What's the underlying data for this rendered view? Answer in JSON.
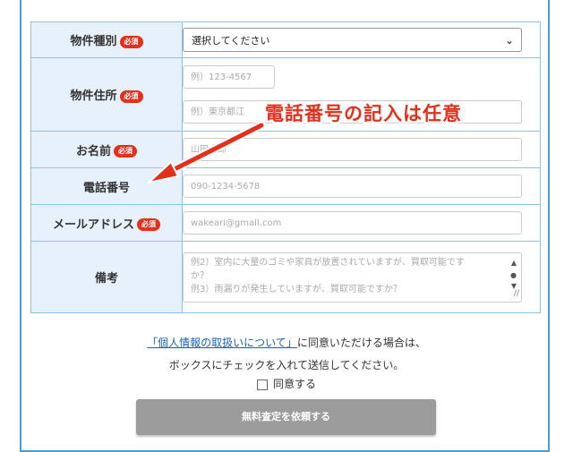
{
  "required_badge": "必須",
  "fields": {
    "property_type": {
      "label": "物件種別",
      "value": "選択してください"
    },
    "property_address": {
      "label": "物件住所",
      "postal_placeholder": "例）123-4567",
      "address_placeholder": "例）東京都江"
    },
    "name": {
      "label": "お名前",
      "placeholder": "山田太郎"
    },
    "phone": {
      "label": "電話番号",
      "placeholder": "090-1234-5678"
    },
    "email": {
      "label": "メールアドレス",
      "placeholder": "wakeari@gmail.com"
    },
    "notes": {
      "label": "備考",
      "placeholder_line1": "例2）室内に大量のゴミや家具が放置されていますが、買取可能です",
      "placeholder_line2": "か？",
      "placeholder_line3": "例3）雨漏りが発生していますが、買取可能ですか？"
    }
  },
  "annotation": {
    "text": "電話番号の記入は任意",
    "color": "#e3301c"
  },
  "consent": {
    "link_text": "「個人情報の取扱いについて」",
    "line1_rest": "に同意いただける場合は、",
    "line2": "ボックスにチェックを入れて送信してください。",
    "checkbox_label": "同意する",
    "checked": false
  },
  "submit_label": "無料査定を依頼する",
  "colors": {
    "accent_blue": "#4a9fd8",
    "label_bg": "#e7f1fb",
    "required_red": "#e3301c",
    "button_gray": "#9c9c9c"
  }
}
